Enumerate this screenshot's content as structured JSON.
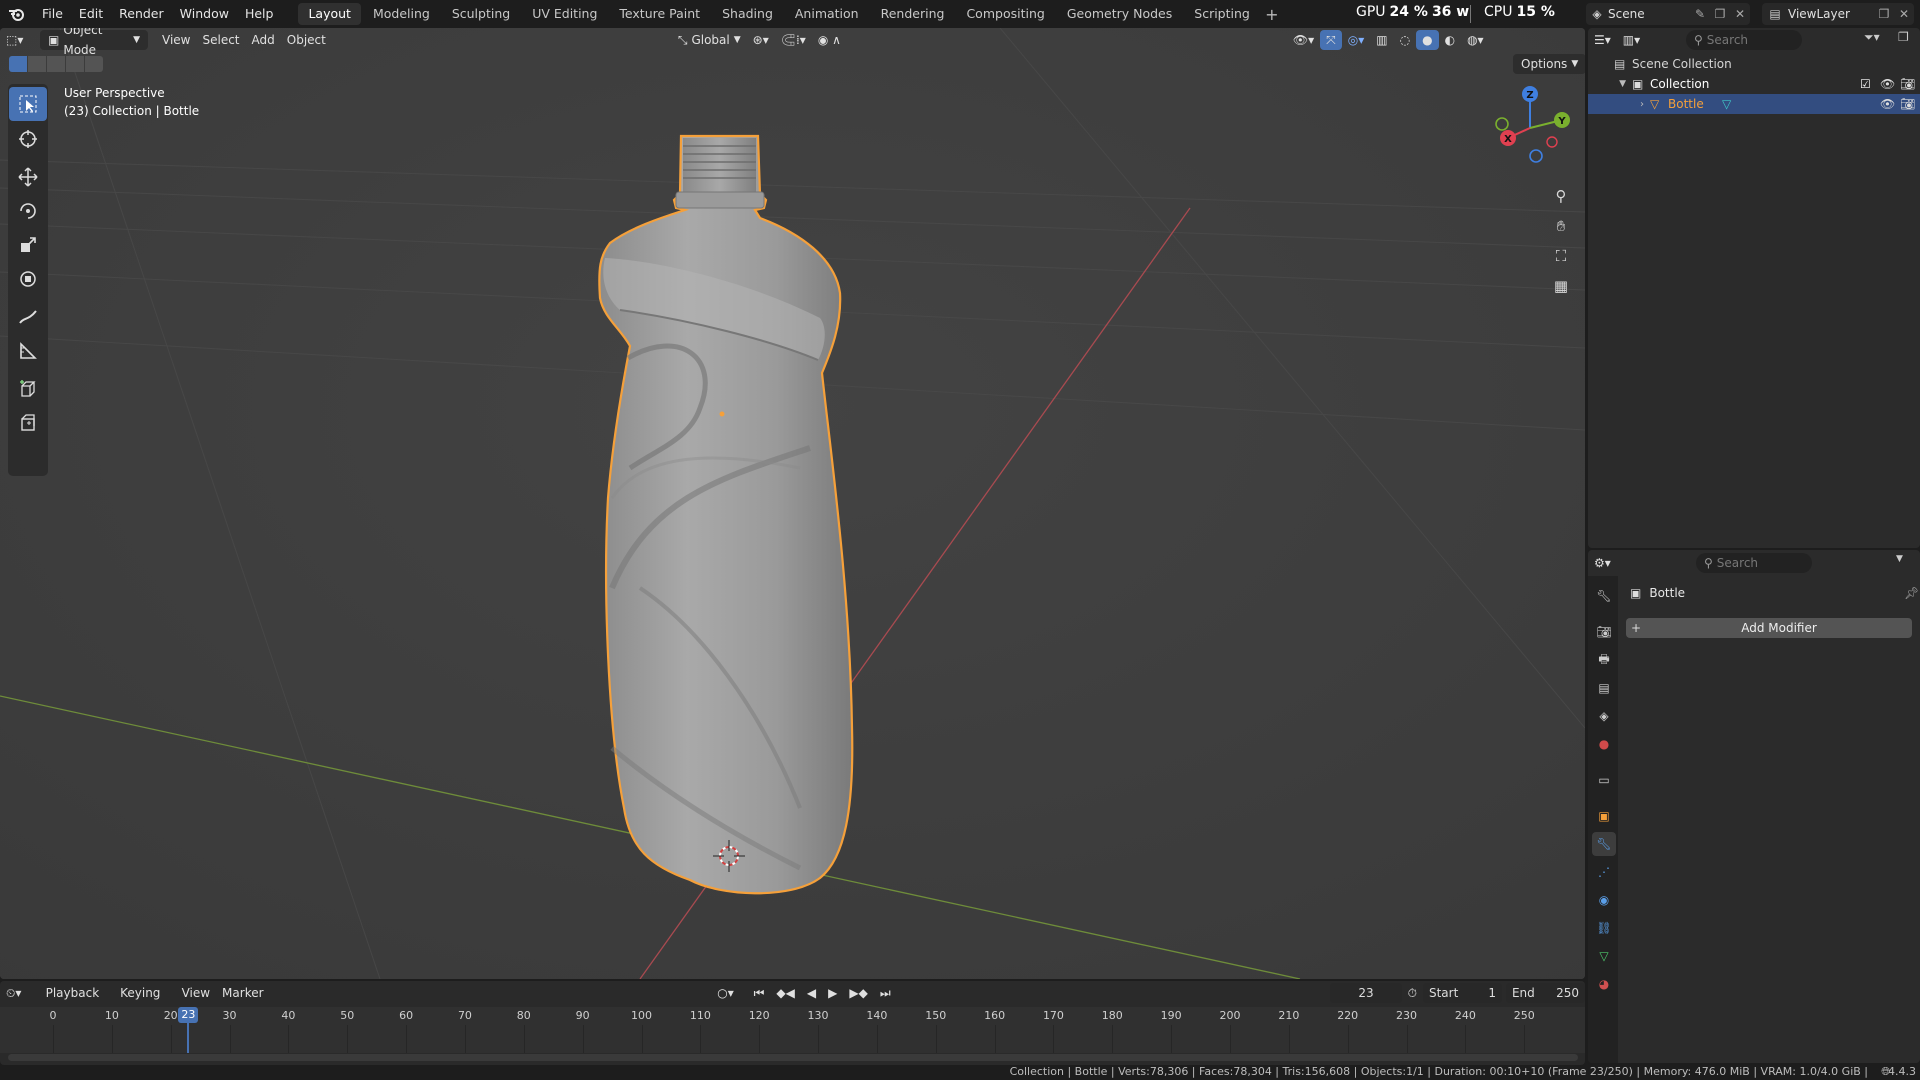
{
  "topbar": {
    "menus": [
      "File",
      "Edit",
      "Render",
      "Window",
      "Help"
    ],
    "workspaces": [
      "Layout",
      "Modeling",
      "Sculpting",
      "UV Editing",
      "Texture Paint",
      "Shading",
      "Animation",
      "Rendering",
      "Compositing",
      "Geometry Nodes",
      "Scripting"
    ],
    "active_workspace": "Layout",
    "gpu_label": "GPU",
    "gpu_value": "24 %",
    "gpu_power": "36 w",
    "cpu_label": "CPU",
    "cpu_value": "15 %",
    "scene": "Scene",
    "view_layer": "ViewLayer"
  },
  "viewport": {
    "mode": "Object Mode",
    "menus": [
      "View",
      "Select",
      "Add",
      "Object"
    ],
    "transform_orientation": "Global",
    "options": "Options",
    "perspective": "User Perspective",
    "context": "(23) Collection | Bottle",
    "gizmo": {
      "x": "X",
      "y": "Y",
      "z": "Z"
    }
  },
  "timeline": {
    "menus": [
      "Playback",
      "Keying",
      "View",
      "Marker"
    ],
    "current_frame": "23",
    "start_label": "Start",
    "start": "1",
    "end_label": "End",
    "end": "250",
    "ticks": [
      "0",
      "10",
      "20",
      "30",
      "40",
      "50",
      "60",
      "70",
      "80",
      "90",
      "100",
      "110",
      "120",
      "130",
      "140",
      "150",
      "160",
      "170",
      "180",
      "190",
      "200",
      "210",
      "220",
      "230",
      "240",
      "250"
    ]
  },
  "outliner": {
    "search_placeholder": "Search",
    "scene_collection": "Scene Collection",
    "collection": "Collection",
    "object": "Bottle"
  },
  "properties": {
    "search_placeholder": "Search",
    "object_name": "Bottle",
    "add_modifier": "Add Modifier"
  },
  "statusbar": {
    "text": "Collection | Bottle | Verts:78,306 | Faces:78,304 | Tris:156,608 | Objects:1/1 | Duration: 00:10+10 (Frame 23/250) | Memory: 476.0 MiB | VRAM: 1.0/4.0 GiB |",
    "version": "4.4.3"
  },
  "colors": {
    "accent": "#4772b3",
    "selection_outline": "#f5a03a",
    "viewport_bg": "#3d3d3d",
    "axis_x": "#e04050",
    "axis_y": "#7ab02e",
    "axis_z": "#3f7fe0"
  }
}
